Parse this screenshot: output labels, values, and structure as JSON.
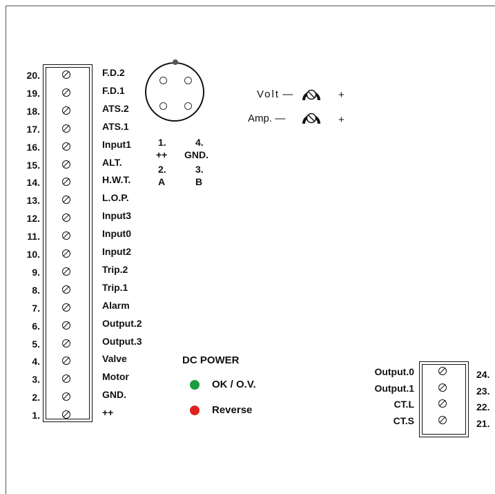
{
  "left_terminals": [
    {
      "num": "20.",
      "label": "F.D.2"
    },
    {
      "num": "19.",
      "label": "F.D.1"
    },
    {
      "num": "18.",
      "label": "ATS.2"
    },
    {
      "num": "17.",
      "label": "ATS.1"
    },
    {
      "num": "16.",
      "label": "Input1"
    },
    {
      "num": "15.",
      "label": "ALT."
    },
    {
      "num": "14.",
      "label": "H.W.T."
    },
    {
      "num": "13.",
      "label": "L.O.P."
    },
    {
      "num": "12.",
      "label": "Input3"
    },
    {
      "num": "11.",
      "label": "Input0"
    },
    {
      "num": "10.",
      "label": "Input2"
    },
    {
      "num": "9.",
      "label": "Trip.2"
    },
    {
      "num": "8.",
      "label": "Trip.1"
    },
    {
      "num": "7.",
      "label": "Alarm"
    },
    {
      "num": "6.",
      "label": "Output.2"
    },
    {
      "num": "5.",
      "label": "Output.3"
    },
    {
      "num": "4.",
      "label": "Valve"
    },
    {
      "num": "3.",
      "label": "Motor"
    },
    {
      "num": "2.",
      "label": "GND."
    },
    {
      "num": "1.",
      "label": "++"
    }
  ],
  "right_terminals": [
    {
      "num": "24.",
      "label": "Output.0"
    },
    {
      "num": "23.",
      "label": "Output.1"
    },
    {
      "num": "22.",
      "label": "CT.L"
    },
    {
      "num": "21.",
      "label": "CT.S"
    }
  ],
  "connector": {
    "pin1_num": "1.",
    "pin1_label": "++",
    "pin2_num": "2.",
    "pin2_label": "A",
    "pin3_num": "3.",
    "pin3_label": "B",
    "pin4_num": "4.",
    "pin4_label": "GND."
  },
  "adjusters": {
    "volt_label": "Volt",
    "amp_label": "Amp.",
    "minus": "—",
    "plus": "+"
  },
  "dc_power": {
    "title": "DC POWER",
    "ok_label": "OK / O.V.",
    "ok_color": "#1a9e3f",
    "reverse_label": "Reverse",
    "reverse_color": "#e02020"
  }
}
